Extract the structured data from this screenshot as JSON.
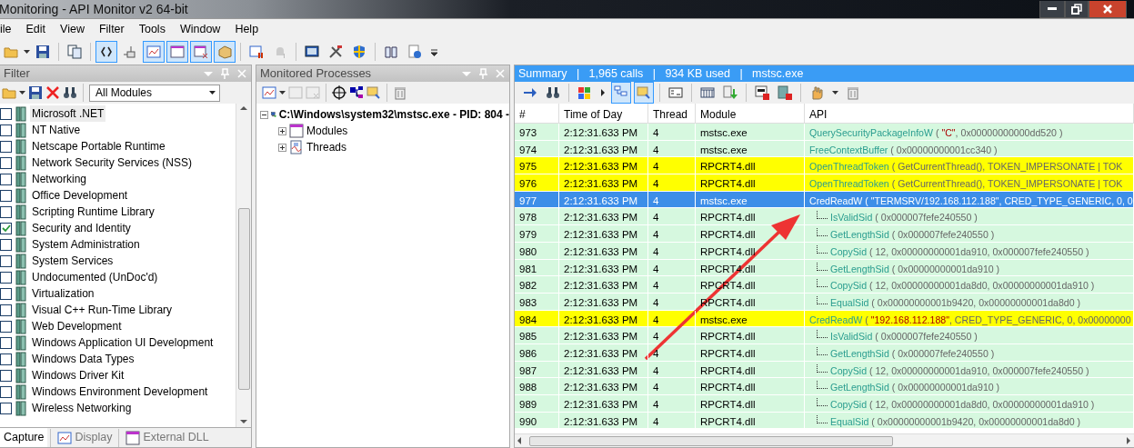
{
  "window": {
    "title": "Monitoring - API Monitor v2 64-bit"
  },
  "menu": [
    "ile",
    "Edit",
    "View",
    "Filter",
    "Tools",
    "Window",
    "Help"
  ],
  "toolbar": [
    {
      "pressed": false
    },
    {
      "pressed": false
    },
    {
      "pressed": false
    },
    {
      "pressed": true
    },
    {
      "pressed": false
    },
    {
      "pressed": true
    },
    {
      "pressed": true
    },
    {
      "pressed": true
    },
    {
      "pressed": true
    },
    {
      "pressed": false
    },
    {
      "pressed": false
    },
    {
      "pressed": false
    },
    {
      "pressed": false
    },
    {
      "pressed": false
    },
    {
      "pressed": false
    },
    {
      "pressed": false
    }
  ],
  "filter_panel": {
    "title": "Filter",
    "module_select": "All Modules",
    "items": [
      {
        "label": "Microsoft .NET",
        "checked": false,
        "selected": true
      },
      {
        "label": "NT Native",
        "checked": false,
        "selected": false
      },
      {
        "label": "Netscape Portable Runtime",
        "checked": false,
        "selected": false
      },
      {
        "label": "Network Security Services (NSS)",
        "checked": false,
        "selected": false
      },
      {
        "label": "Networking",
        "checked": false,
        "selected": false
      },
      {
        "label": "Office Development",
        "checked": false,
        "selected": false
      },
      {
        "label": "Scripting Runtime Library",
        "checked": false,
        "selected": false
      },
      {
        "label": "Security and Identity",
        "checked": true,
        "selected": false
      },
      {
        "label": "System Administration",
        "checked": false,
        "selected": false
      },
      {
        "label": "System Services",
        "checked": false,
        "selected": false
      },
      {
        "label": "Undocumented (UnDoc'd)",
        "checked": false,
        "selected": false
      },
      {
        "label": "Virtualization",
        "checked": false,
        "selected": false
      },
      {
        "label": "Visual C++ Run-Time Library",
        "checked": false,
        "selected": false
      },
      {
        "label": "Web Development",
        "checked": false,
        "selected": false
      },
      {
        "label": "Windows Application UI Development",
        "checked": false,
        "selected": false
      },
      {
        "label": "Windows Data Types",
        "checked": false,
        "selected": false
      },
      {
        "label": "Windows Driver Kit",
        "checked": false,
        "selected": false
      },
      {
        "label": "Windows Environment Development",
        "checked": false,
        "selected": false
      },
      {
        "label": "Wireless Networking",
        "checked": false,
        "selected": false
      }
    ],
    "tabs": [
      {
        "label": "Capture",
        "selected": true
      },
      {
        "label": "Display",
        "selected": false
      },
      {
        "label": "External DLL",
        "selected": false
      }
    ]
  },
  "processes_panel": {
    "title": "Monitored Processes",
    "tree": [
      {
        "label": "C:\\Windows\\system32\\mstsc.exe - PID: 804 -",
        "expanded": true,
        "children": [
          {
            "label": "Modules",
            "expanded": false
          },
          {
            "label": "Threads",
            "expanded": false
          }
        ]
      }
    ]
  },
  "summary_bar": "Summary   |   1,965 calls   |   934 KB used   |   mstsc.exe",
  "right_toolbar": [
    {
      "pressed": false
    },
    {
      "pressed": false
    },
    {
      "pressed": false
    },
    {
      "pressed": false
    },
    {
      "pressed": true
    },
    {
      "pressed": true
    },
    {
      "pressed": false
    },
    {
      "pressed": false
    },
    {
      "pressed": false
    },
    {
      "pressed": false
    },
    {
      "pressed": false
    },
    {
      "pressed": false
    },
    {
      "pressed": false
    },
    {
      "pressed": false
    }
  ],
  "table": {
    "columns": [
      "#",
      "Time of Day",
      "Thread",
      "Module",
      "API"
    ],
    "rows": [
      {
        "num": "973",
        "time": "2:12:31.633 PM",
        "thread": "4",
        "module": "mstsc.exe",
        "highlight": false,
        "selected": false,
        "api": "QuerySecurityPackageInfoW",
        "args": [
          {
            "text": " ( ",
            "kind": "plain"
          },
          {
            "text": "\"C\"",
            "kind": "string"
          },
          {
            "text": ", 0x00000000000dd520 )",
            "kind": "plain"
          }
        ]
      },
      {
        "num": "974",
        "time": "2:12:31.633 PM",
        "thread": "4",
        "module": "mstsc.exe",
        "highlight": false,
        "selected": false,
        "api": "FreeContextBuffer",
        "args": [
          {
            "text": " ( 0x00000000001cc340 )",
            "kind": "plain"
          }
        ]
      },
      {
        "num": "975",
        "time": "2:12:31.633 PM",
        "thread": "4",
        "module": "RPCRT4.dll",
        "highlight": true,
        "selected": false,
        "api": "OpenThreadToken",
        "args": [
          {
            "text": " ( GetCurrentThread(), TOKEN_IMPERSONATE | TOK",
            "kind": "plain"
          }
        ]
      },
      {
        "num": "976",
        "time": "2:12:31.633 PM",
        "thread": "4",
        "module": "RPCRT4.dll",
        "highlight": true,
        "selected": false,
        "api": "OpenThreadToken",
        "args": [
          {
            "text": " ( GetCurrentThread(), TOKEN_IMPERSONATE | TOK",
            "kind": "plain"
          }
        ]
      },
      {
        "num": "977",
        "time": "2:12:31.633 PM",
        "thread": "4",
        "module": "mstsc.exe",
        "highlight": false,
        "selected": true,
        "api": "CredReadW",
        "args": [
          {
            "text": " ( ",
            "kind": "plain"
          },
          {
            "text": "\"TERMSRV/192.168.112.188\"",
            "kind": "string"
          },
          {
            "text": ", CRED_TYPE_GENERIC, 0, 0",
            "kind": "plain"
          }
        ],
        "children": [
          {
            "num": "978",
            "time": "2:12:31.633 PM",
            "thread": "4",
            "module": "RPCRT4.dll",
            "highlight": false,
            "selected": false,
            "api": "IsValidSid",
            "args": [
              {
                "text": " ( 0x000007fefe240550 )",
                "kind": "plain"
              }
            ]
          },
          {
            "num": "979",
            "time": "2:12:31.633 PM",
            "thread": "4",
            "module": "RPCRT4.dll",
            "highlight": false,
            "selected": false,
            "api": "GetLengthSid",
            "args": [
              {
                "text": " ( 0x000007fefe240550 )",
                "kind": "plain"
              }
            ]
          },
          {
            "num": "980",
            "time": "2:12:31.633 PM",
            "thread": "4",
            "module": "RPCRT4.dll",
            "highlight": false,
            "selected": false,
            "api": "CopySid",
            "args": [
              {
                "text": " ( 12, 0x00000000001da910, 0x000007fefe240550 )",
                "kind": "plain"
              }
            ]
          },
          {
            "num": "981",
            "time": "2:12:31.633 PM",
            "thread": "4",
            "module": "RPCRT4.dll",
            "highlight": false,
            "selected": false,
            "api": "GetLengthSid",
            "args": [
              {
                "text": " ( 0x00000000001da910 )",
                "kind": "plain"
              }
            ]
          },
          {
            "num": "982",
            "time": "2:12:31.633 PM",
            "thread": "4",
            "module": "RPCRT4.dll",
            "highlight": false,
            "selected": false,
            "api": "CopySid",
            "args": [
              {
                "text": " ( 12, 0x00000000001da8d0, 0x00000000001da910 )",
                "kind": "plain"
              }
            ]
          },
          {
            "num": "983",
            "time": "2:12:31.633 PM",
            "thread": "4",
            "module": "RPCRT4.dll",
            "highlight": false,
            "selected": false,
            "api": "EqualSid",
            "args": [
              {
                "text": " ( 0x00000000001b9420, 0x00000000001da8d0 )",
                "kind": "plain"
              }
            ]
          }
        ]
      },
      {
        "num": "984",
        "time": "2:12:31.633 PM",
        "thread": "4",
        "module": "mstsc.exe",
        "highlight": true,
        "selected": false,
        "api": "CredReadW",
        "args": [
          {
            "text": " ( ",
            "kind": "plain"
          },
          {
            "text": "\"192.168.112.188\"",
            "kind": "string"
          },
          {
            "text": ", CRED_TYPE_GENERIC, 0, 0x00000000",
            "kind": "plain"
          }
        ],
        "children": [
          {
            "num": "985",
            "time": "2:12:31.633 PM",
            "thread": "4",
            "module": "RPCRT4.dll",
            "highlight": false,
            "selected": false,
            "api": "IsValidSid",
            "args": [
              {
                "text": " ( 0x000007fefe240550 )",
                "kind": "plain"
              }
            ]
          },
          {
            "num": "986",
            "time": "2:12:31.633 PM",
            "thread": "4",
            "module": "RPCRT4.dll",
            "highlight": false,
            "selected": false,
            "api": "GetLengthSid",
            "args": [
              {
                "text": " ( 0x000007fefe240550 )",
                "kind": "plain"
              }
            ]
          },
          {
            "num": "987",
            "time": "2:12:31.633 PM",
            "thread": "4",
            "module": "RPCRT4.dll",
            "highlight": false,
            "selected": false,
            "api": "CopySid",
            "args": [
              {
                "text": " ( 12, 0x00000000001da910, 0x000007fefe240550 )",
                "kind": "plain"
              }
            ]
          },
          {
            "num": "988",
            "time": "2:12:31.633 PM",
            "thread": "4",
            "module": "RPCRT4.dll",
            "highlight": false,
            "selected": false,
            "api": "GetLengthSid",
            "args": [
              {
                "text": " ( 0x00000000001da910 )",
                "kind": "plain"
              }
            ]
          },
          {
            "num": "989",
            "time": "2:12:31.633 PM",
            "thread": "4",
            "module": "RPCRT4.dll",
            "highlight": false,
            "selected": false,
            "api": "CopySid",
            "args": [
              {
                "text": " ( 12, 0x00000000001da8d0, 0x00000000001da910 )",
                "kind": "plain"
              }
            ]
          },
          {
            "num": "990",
            "time": "2:12:31.633 PM",
            "thread": "4",
            "module": "RPCRT4.dll",
            "highlight": false,
            "selected": false,
            "api": "EqualSid",
            "args": [
              {
                "text": " ( 0x00000000001b9420, 0x00000000001da8d0 )",
                "kind": "plain"
              }
            ]
          }
        ]
      }
    ]
  }
}
